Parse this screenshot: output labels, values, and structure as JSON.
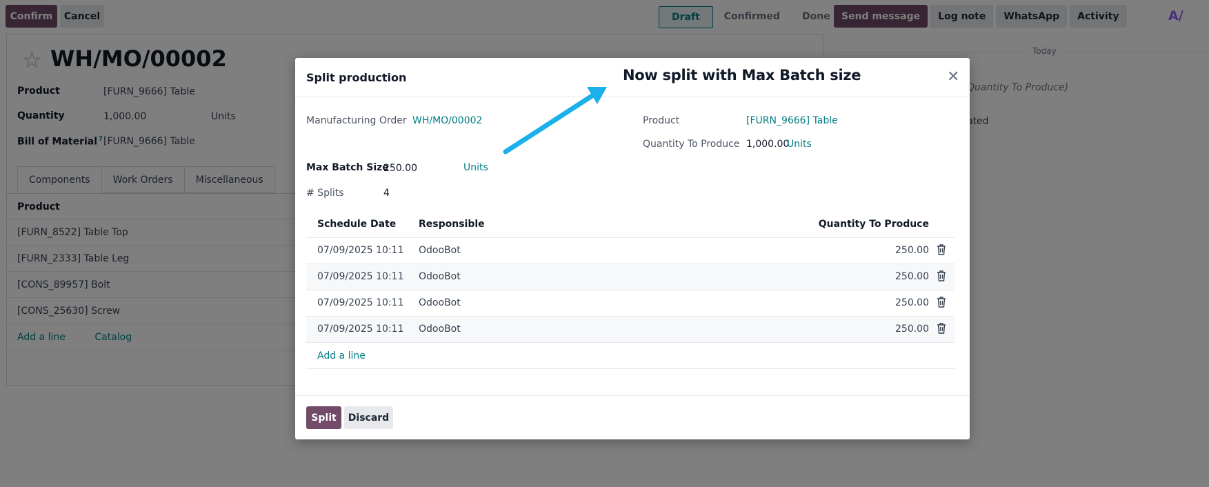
{
  "control_panel": {
    "confirm_label": "Confirm",
    "cancel_label": "Cancel",
    "stages": [
      "Draft",
      "Confirmed",
      "Done"
    ]
  },
  "chatter": {
    "send_message": "Send message",
    "log_note": "Log note",
    "whatsapp": "WhatsApp",
    "activity": "Activity",
    "today": "Today",
    "partial_text_1": "Quantity To Produce)",
    "partial_text_2": "ated"
  },
  "form": {
    "name": "WH/MO/00002",
    "product_label": "Product",
    "product_value": "[FURN_9666] Table",
    "quantity_label": "Quantity",
    "quantity_value": "1,000.00",
    "quantity_uom": "Units",
    "bom_label": "Bill of Material",
    "bom_help": "?",
    "bom_value": "[FURN_9666] Table",
    "tabs": [
      "Components",
      "Work Orders",
      "Miscellaneous"
    ],
    "components_header": "Product",
    "components": [
      "[FURN_8522] Table Top",
      "[FURN_2333] Table Leg",
      "[CONS_89957] Bolt",
      "[CONS_25630] Screw"
    ],
    "add_line": "Add a line",
    "catalog": "Catalog"
  },
  "modal": {
    "title": "Split production",
    "annotation": "Now split with Max Batch size",
    "mo_label": "Manufacturing Order",
    "mo_value": "WH/MO/00002",
    "product_label": "Product",
    "product_value": "[FURN_9666] Table",
    "qty_label": "Quantity To Produce",
    "qty_value": "1,000.00",
    "qty_uom": "Units",
    "batch_label": "Max Batch Size",
    "batch_value": "250.00",
    "batch_uom": "Units",
    "splits_label": "# Splits",
    "splits_value": "4",
    "columns": [
      "Schedule Date",
      "Responsible",
      "Quantity To Produce"
    ],
    "rows": [
      {
        "date": "07/09/2025 10:11",
        "responsible": "OdooBot",
        "qty": "250.00"
      },
      {
        "date": "07/09/2025 10:11",
        "responsible": "OdooBot",
        "qty": "250.00"
      },
      {
        "date": "07/09/2025 10:11",
        "responsible": "OdooBot",
        "qty": "250.00"
      },
      {
        "date": "07/09/2025 10:11",
        "responsible": "OdooBot",
        "qty": "250.00"
      }
    ],
    "add_line": "Add a line",
    "split_button": "Split",
    "discard_button": "Discard"
  },
  "colors": {
    "primary": "#714b67",
    "link": "#017e84",
    "arrow": "#1ab1ea"
  },
  "icons": {
    "star": "star-icon",
    "close": "close-icon",
    "trash": "trash-icon",
    "ai": "ai-logo-icon"
  }
}
